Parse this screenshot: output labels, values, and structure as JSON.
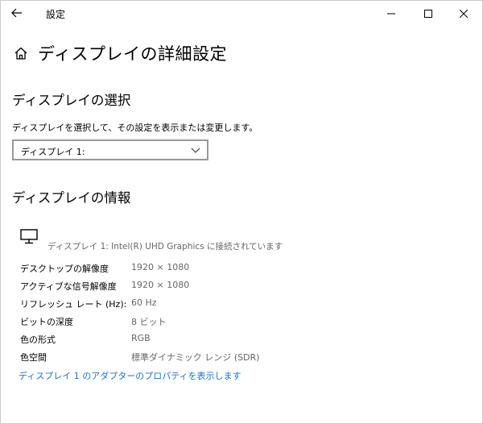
{
  "window": {
    "back_icon": "arrow-left-icon",
    "title": "設定",
    "minimize_icon": "minimize-icon",
    "maximize_icon": "maximize-icon",
    "close_icon": "close-icon"
  },
  "page": {
    "home_icon": "home-icon",
    "title": "ディスプレイの詳細設定"
  },
  "select_section": {
    "title": "ディスプレイの選択",
    "description": "ディスプレイを選択して、その設定を表示または変更します。",
    "dropdown_value": "ディスプレイ 1:"
  },
  "info_section": {
    "title": "ディスプレイの情報",
    "monitor_icon": "monitor-icon",
    "connection": "ディスプレイ 1: Intel(R) UHD Graphics に接続されています",
    "rows": [
      {
        "label": "デスクトップの解像度",
        "value": "1920 × 1080"
      },
      {
        "label": "アクティブな信号解像度",
        "value": "1920 × 1080"
      },
      {
        "label": "リフレッシュ レート (Hz):",
        "value": "60 Hz"
      },
      {
        "label": "ビットの深度",
        "value": "8 ビット"
      },
      {
        "label": "色の形式",
        "value": "RGB"
      },
      {
        "label": "色空間",
        "value": "標準ダイナミック レンジ (SDR)"
      }
    ],
    "adapter_link": "ディスプレイ 1 のアダプターのプロパティを表示します"
  },
  "colors": {
    "link": "#1a73c8",
    "secondary_text": "#666666",
    "dropdown_border": "#999999"
  }
}
